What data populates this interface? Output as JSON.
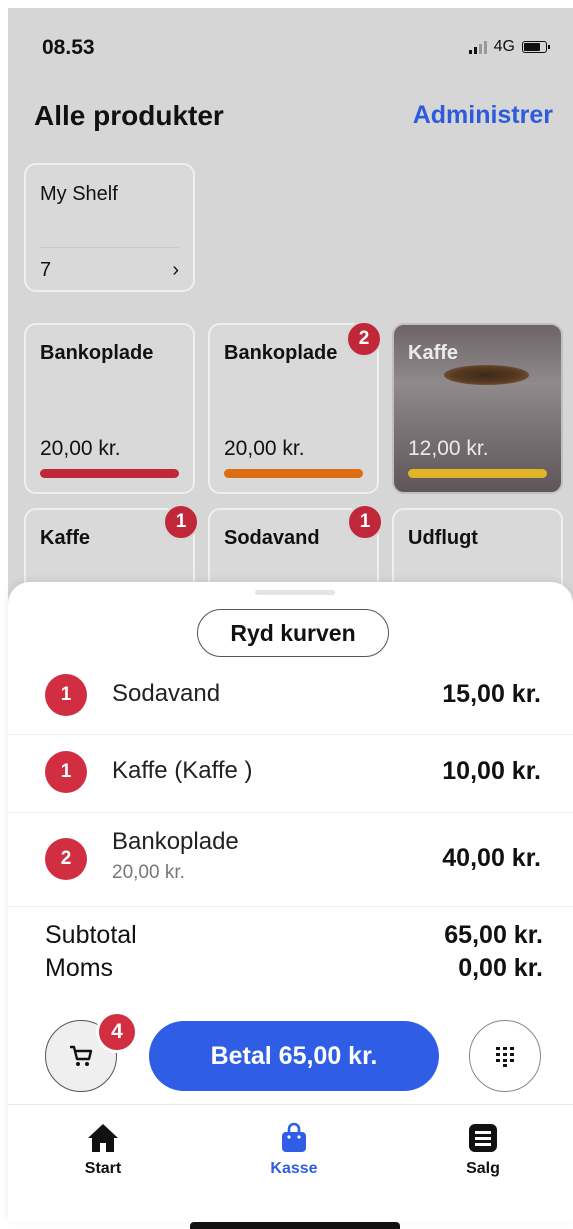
{
  "status_bar": {
    "time": "08.53",
    "network": "4G"
  },
  "header": {
    "title": "Alle produkter",
    "action": "Administrer"
  },
  "shelf": {
    "name": "My Shelf",
    "count": "7",
    "chevron": "›"
  },
  "products": [
    {
      "name": "Bankoplade",
      "price": "20,00 kr.",
      "color": "#c0283a",
      "badge": ""
    },
    {
      "name": "Bankoplade",
      "price": "20,00 kr.",
      "color": "#dd6d12",
      "badge": "2"
    },
    {
      "name": "Kaffe",
      "price": "12,00 kr.",
      "color": "#e0b528",
      "badge": ""
    },
    {
      "name": "Kaffe",
      "badge": "1"
    },
    {
      "name": "Sodavand",
      "badge": "1"
    },
    {
      "name": "Udflugt",
      "badge": ""
    }
  ],
  "basket": {
    "clear_label": "Ryd kurven",
    "items": [
      {
        "qty": "1",
        "name": "Sodavand",
        "total": "15,00 kr."
      },
      {
        "qty": "1",
        "name": "Kaffe (Kaffe )",
        "total": "10,00 kr."
      },
      {
        "qty": "2",
        "name": "Bankoplade",
        "unit_price": "20,00 kr.",
        "total": "40,00 kr."
      }
    ],
    "subtotal_label": "Subtotal",
    "subtotal_value": "65,00 kr.",
    "vat_label": "Moms",
    "vat_value": "0,00 kr."
  },
  "actions": {
    "cart_count": "4",
    "pay_label": "Betal 65,00 kr."
  },
  "tabs": [
    {
      "label": "Start",
      "icon": "home-icon"
    },
    {
      "label": "Kasse",
      "icon": "bag-icon",
      "active": true
    },
    {
      "label": "Salg",
      "icon": "list-icon"
    }
  ],
  "colors": {
    "accent": "#2f5de6",
    "badge": "#d12f41"
  }
}
